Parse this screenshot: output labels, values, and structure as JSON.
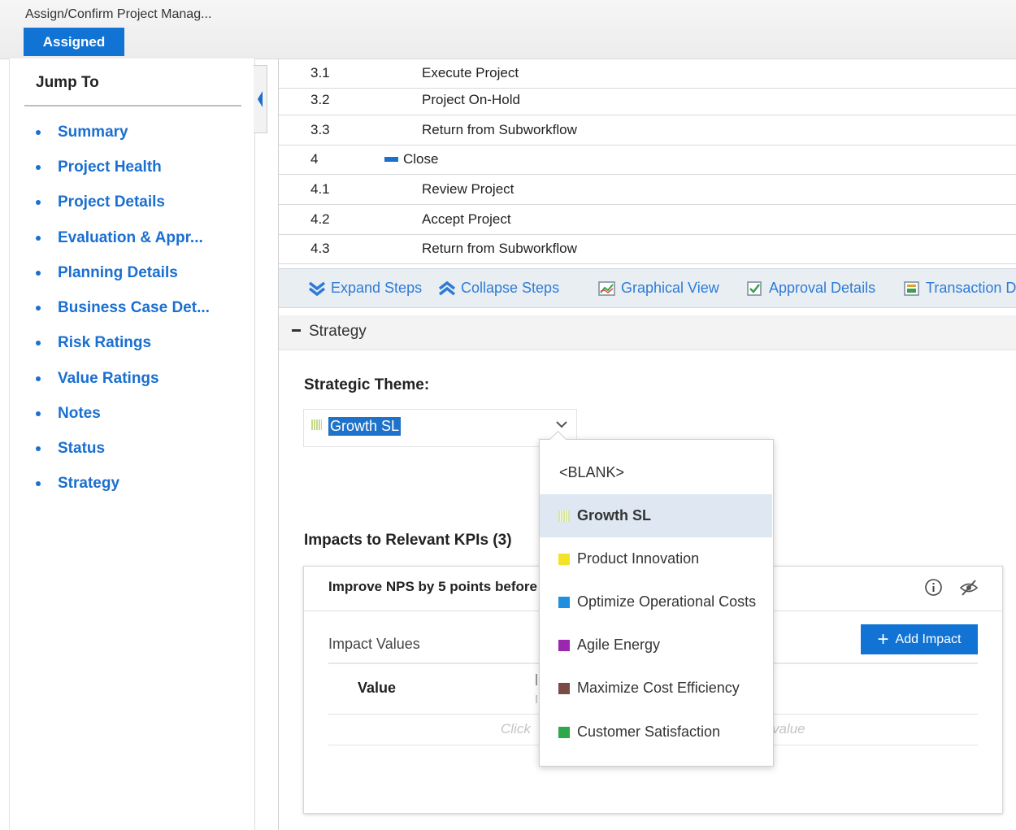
{
  "header": {
    "title": "Assign/Confirm Project Manag...",
    "status": "Assigned"
  },
  "sidebar": {
    "title": "Jump To",
    "items": [
      {
        "label": "Summary"
      },
      {
        "label": "Project Health"
      },
      {
        "label": "Project Details"
      },
      {
        "label": "Evaluation & Appr..."
      },
      {
        "label": "Planning Details"
      },
      {
        "label": "Business Case Det..."
      },
      {
        "label": "Risk Ratings"
      },
      {
        "label": "Value Ratings"
      },
      {
        "label": "Notes"
      },
      {
        "label": "Status"
      },
      {
        "label": "Strategy"
      }
    ]
  },
  "steps": [
    {
      "num": "3.1",
      "name": "Execute Project"
    },
    {
      "num": "3.2",
      "name": "Project On-Hold"
    },
    {
      "num": "3.3",
      "name": "Return from Subworkflow"
    },
    {
      "num": "4",
      "name": "Close"
    },
    {
      "num": "4.1",
      "name": "Review Project"
    },
    {
      "num": "4.2",
      "name": "Accept Project"
    },
    {
      "num": "4.3",
      "name": "Return from Subworkflow"
    }
  ],
  "toolbar": {
    "expand": "Expand Steps",
    "collapse": "Collapse Steps",
    "graphical": "Graphical View",
    "approval": "Approval Details",
    "transaction": "Transaction D"
  },
  "strategy": {
    "section_title": "Strategy",
    "theme_label": "Strategic Theme:",
    "theme_value": "Growth SL",
    "impacts_title": "Impacts to Relevant KPIs (3)",
    "kpi_title": "Improve NPS by 5 points before",
    "impact_values_label": "Impact Values",
    "add_impact": "Add Impact",
    "value_column": "Value",
    "hint_left": "Click",
    "hint_right": "value"
  },
  "dropdown": {
    "options": [
      {
        "label": "<BLANK>",
        "color": null
      },
      {
        "label": "Growth SL",
        "color": "#d9e6a0",
        "selected": true
      },
      {
        "label": "Product Innovation",
        "color": "#f2e22a"
      },
      {
        "label": "Optimize Operational Costs",
        "color": "#1f8fe0"
      },
      {
        "label": "Agile Energy",
        "color": "#9b27b0"
      },
      {
        "label": "Maximize Cost Efficiency",
        "color": "#7a4a44"
      },
      {
        "label": "Customer Satisfaction",
        "color": "#2fa84a"
      }
    ]
  },
  "colors": {
    "accent": "#1173d4",
    "link": "#1a6fd0"
  }
}
